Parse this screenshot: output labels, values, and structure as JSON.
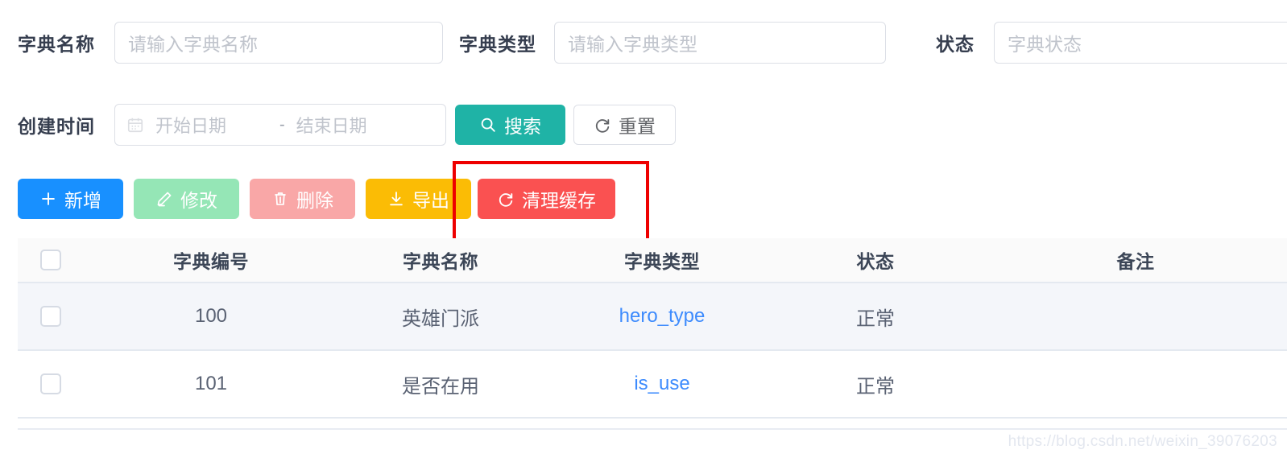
{
  "search_form": {
    "dict_name": {
      "label": "字典名称",
      "value": "",
      "placeholder": "请输入字典名称"
    },
    "dict_type": {
      "label": "字典类型",
      "value": "",
      "placeholder": "请输入字典类型"
    },
    "status": {
      "label": "状态",
      "value": "",
      "placeholder": "字典状态"
    },
    "create_time": {
      "label": "创建时间",
      "start_placeholder": "开始日期",
      "separator": "-",
      "end_placeholder": "结束日期",
      "icon": "calendar-icon"
    },
    "search_button": {
      "label": "搜索",
      "icon": "search-icon",
      "color": "#1fb3a6"
    },
    "reset_button": {
      "label": "重置",
      "icon": "refresh-icon",
      "color": "#ffffff"
    }
  },
  "toolbar": {
    "add": {
      "label": "新增",
      "icon": "plus-icon",
      "color": "#1890ff",
      "disabled": false
    },
    "edit": {
      "label": "修改",
      "icon": "pencil-icon",
      "color": "#95e6b6",
      "disabled": true
    },
    "delete": {
      "label": "删除",
      "icon": "trash-icon",
      "color": "#f9a7a7",
      "disabled": true
    },
    "export": {
      "label": "导出",
      "icon": "download-icon",
      "color": "#fbbc05",
      "disabled": false
    },
    "clear_cache": {
      "label": "清理缓存",
      "icon": "refresh-icon",
      "color": "#fa5151",
      "disabled": false
    }
  },
  "annotation": {
    "color": "#ee0000",
    "target": "清理缓存"
  },
  "table": {
    "columns": [
      {
        "key": "select",
        "label": ""
      },
      {
        "key": "dict_code",
        "label": "字典编号"
      },
      {
        "key": "dict_name",
        "label": "字典名称"
      },
      {
        "key": "dict_type",
        "label": "字典类型"
      },
      {
        "key": "status",
        "label": "状态"
      },
      {
        "key": "remark",
        "label": "备注"
      }
    ],
    "rows": [
      {
        "dict_code": "100",
        "dict_name": "英雄门派",
        "dict_type": "hero_type",
        "status": "正常",
        "remark": "",
        "highlighted": true
      },
      {
        "dict_code": "101",
        "dict_name": "是否在用",
        "dict_type": "is_use",
        "status": "正常",
        "remark": "",
        "highlighted": false
      }
    ]
  },
  "watermark": {
    "text": "https://blog.csdn.net/weixin_39076203"
  }
}
